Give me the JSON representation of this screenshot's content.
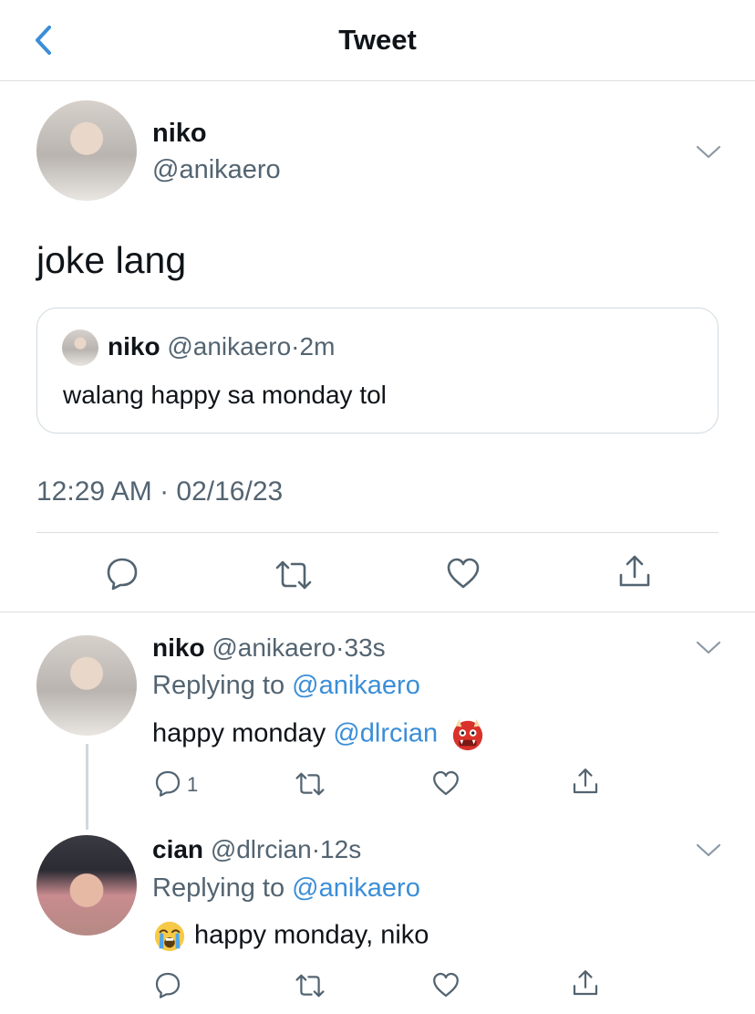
{
  "header": {
    "title": "Tweet"
  },
  "main_tweet": {
    "name": "niko",
    "handle": "@anikaero",
    "text": "joke lang",
    "quote": {
      "name": "niko",
      "handle_time": "@anikaero·2m",
      "text": "walang happy sa monday tol"
    },
    "timestamp": "12:29 AM · 02/16/23"
  },
  "replies": [
    {
      "name": "niko",
      "handle_time": "@anikaero·33s",
      "replying_prefix": "Replying to ",
      "replying_to": "@anikaero",
      "text_before": "happy monday ",
      "mention": "@dlrcian",
      "emoji": "ogre-emoji",
      "reply_count": "1"
    },
    {
      "name": "cian",
      "handle_time": "@dlrcian·12s",
      "replying_prefix": "Replying to ",
      "replying_to": "@anikaero",
      "emoji": "loudly-crying-face-emoji",
      "text": "happy monday, niko"
    }
  ],
  "colors": {
    "accent": "#3b8ed8",
    "secondary_text": "#536471",
    "border": "#cfd9de"
  },
  "icons": [
    "back-chevron-icon",
    "chevron-down-icon",
    "reply-icon",
    "retweet-icon",
    "like-icon",
    "share-icon"
  ]
}
